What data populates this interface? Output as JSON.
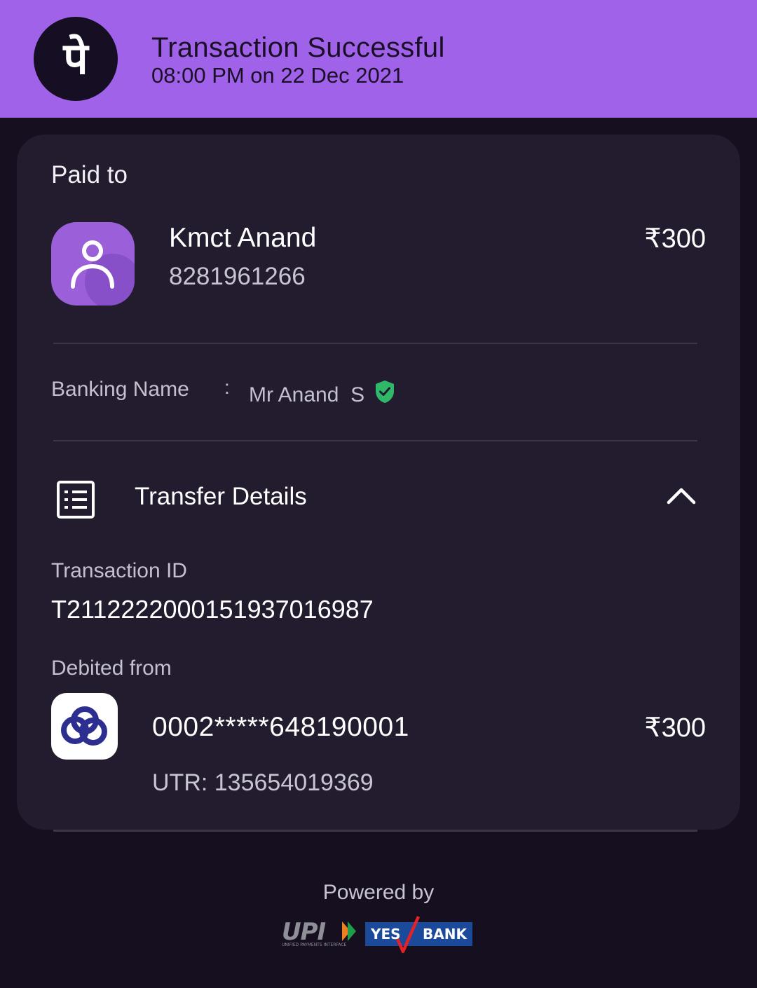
{
  "header": {
    "title": "Transaction Successful",
    "subtitle": "08:00 PM on 22 Dec 2021",
    "logo_glyph": "पे",
    "background_color": "#a162ea"
  },
  "paid_to": {
    "label": "Paid to",
    "name": "Kmct Anand",
    "phone": "8281961266",
    "amount": "₹300"
  },
  "banking": {
    "label": "Banking Name",
    "colon": ":",
    "value": "Mr Anand  S",
    "verified_icon": "shield-check-icon",
    "verified_color": "#2fb86a"
  },
  "transfer_details": {
    "title": "Transfer Details",
    "icon": "list-icon",
    "toggle_icon": "chevron-up-icon",
    "transaction_id_label": "Transaction ID",
    "transaction_id": "T2112222000151937016987",
    "debited_label": "Debited from",
    "bank_icon": "bank-logo-icon",
    "account_number": "0002*****648190001",
    "amount": "₹300",
    "utr": "UTR: 135654019369"
  },
  "footer": {
    "powered_by": "Powered by",
    "upi_label": "UPI",
    "upi_caption": "UNIFIED PAYMENTS INTERFACE",
    "yes_label": "YES",
    "bank_label": "BANK"
  }
}
